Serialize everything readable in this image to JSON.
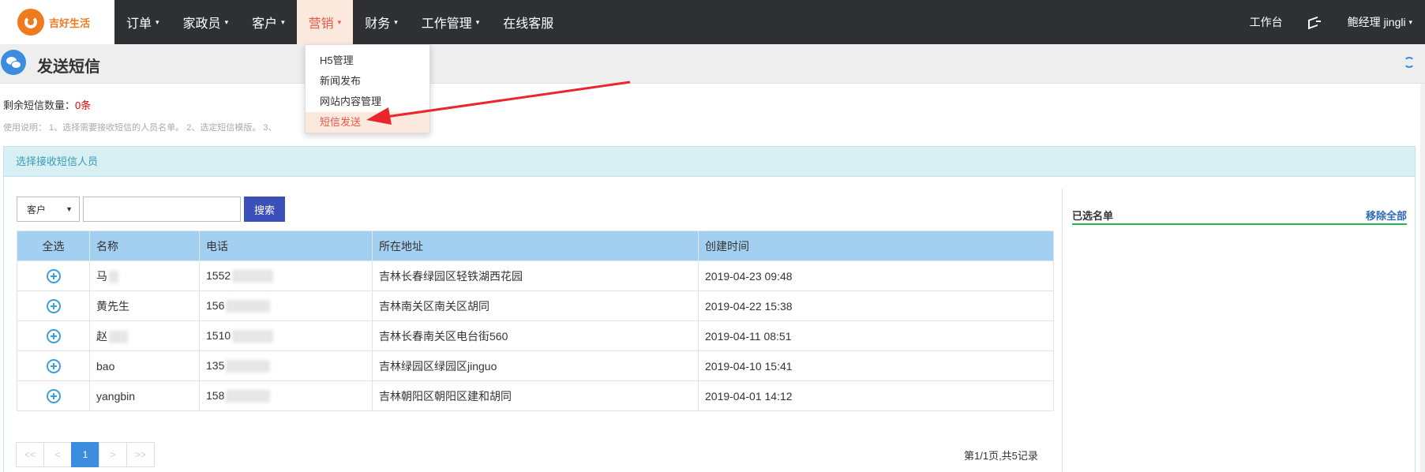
{
  "brand": {
    "name": "吉好生活",
    "color": "#f07a1e"
  },
  "nav": {
    "items": [
      {
        "label": "订单",
        "caret": "▾"
      },
      {
        "label": "家政员",
        "caret": "▾"
      },
      {
        "label": "客户",
        "caret": "▾"
      },
      {
        "label": "营销",
        "caret": "▾",
        "active": true
      },
      {
        "label": "财务",
        "caret": "▾"
      },
      {
        "label": "工作管理",
        "caret": "▾"
      },
      {
        "label": "在线客服",
        "caret": ""
      }
    ],
    "right": {
      "workbench": "工作台",
      "user": "鲍经理",
      "username": "jingli",
      "caret": "▾"
    }
  },
  "dropdown": {
    "items": [
      "H5管理",
      "新闻发布",
      "网站内容管理",
      "短信发送"
    ],
    "active_index": 3
  },
  "page": {
    "title": "发送短信",
    "remaining_label": "剩余短信数量：",
    "remaining_value": "0条",
    "usage": "使用说明： 1、选择需要接收短信的人员名单。  2、选定短信模版。  3、"
  },
  "panel": {
    "title": "选择接收短信人员",
    "search": {
      "type_value": "客户",
      "input_value": "",
      "button": "搜索"
    },
    "columns": [
      "全选",
      "名称",
      "电话",
      "所在地址",
      "创建时间"
    ],
    "rows": [
      {
        "name": "马",
        "phone": "1552",
        "address": "吉林长春绿园区轻铁湖西花园",
        "created": "2019-04-23 09:48"
      },
      {
        "name": "黄先生",
        "phone": "156",
        "address": "吉林南关区南关区胡同",
        "created": "2019-04-22 15:38"
      },
      {
        "name": "赵",
        "phone": "1510",
        "address": "吉林长春南关区电台街560",
        "created": "2019-04-11 08:51"
      },
      {
        "name": "bao",
        "phone": "135",
        "address": "吉林绿园区绿园区jinguo",
        "created": "2019-04-10 15:41"
      },
      {
        "name": "yangbin",
        "phone": "158",
        "address": "吉林朝阳区朝阳区建和胡同",
        "created": "2019-04-01 14:12"
      }
    ],
    "pager": {
      "first": "<<",
      "prev": "<",
      "current": "1",
      "next": ">",
      "last": ">>",
      "info": "第1/1页,共5记录"
    }
  },
  "side": {
    "title": "已选名单",
    "remove_all": "移除全部"
  },
  "colors": {
    "accent": "#3c8dde",
    "active_menu": "#e8584a",
    "header_bg": "#a3d0f0",
    "annotation": "#e8262b"
  }
}
